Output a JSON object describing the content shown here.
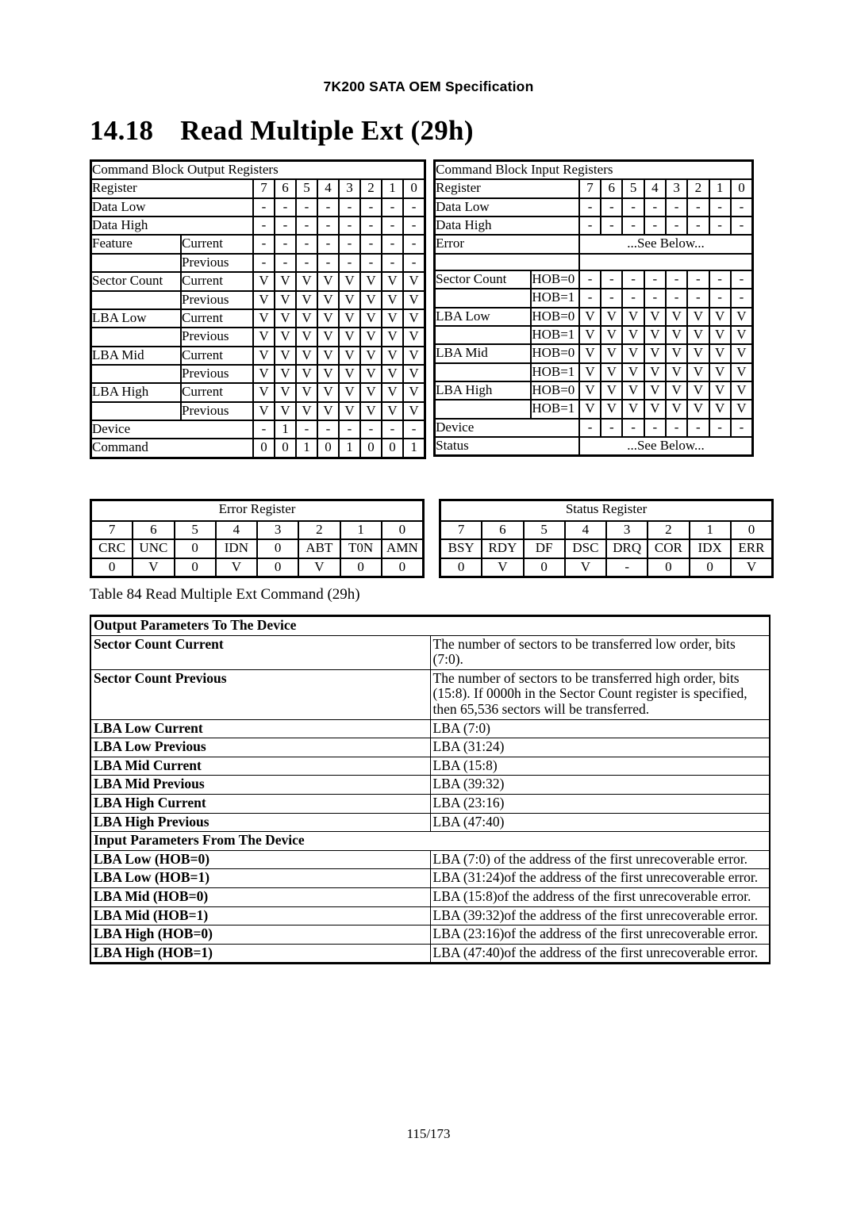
{
  "header": {
    "running_title": "7K200 SATA OEM Specification"
  },
  "section": {
    "number": "14.18",
    "title": "Read Multiple Ext (29h)"
  },
  "command_block": {
    "output": {
      "panel_title": "Command Block Output Registers",
      "register_label": "Register",
      "bit_headers": [
        "7",
        "6",
        "5",
        "4",
        "3",
        "2",
        "1",
        "0"
      ],
      "rows": [
        {
          "name": "Data Low",
          "sub": "",
          "values": [
            "-",
            "-",
            "-",
            "-",
            "-",
            "-",
            "-",
            "-"
          ]
        },
        {
          "name": "Data High",
          "sub": "",
          "values": [
            "-",
            "-",
            "-",
            "-",
            "-",
            "-",
            "-",
            "-"
          ]
        },
        {
          "name": "Feature",
          "sub": "Current",
          "values": [
            "-",
            "-",
            "-",
            "-",
            "-",
            "-",
            "-",
            "-"
          ]
        },
        {
          "name": "",
          "sub": "Previous",
          "values": [
            "-",
            "-",
            "-",
            "-",
            "-",
            "-",
            "-",
            "-"
          ]
        },
        {
          "name": "Sector Count",
          "sub": "Current",
          "values": [
            "V",
            "V",
            "V",
            "V",
            "V",
            "V",
            "V",
            "V"
          ]
        },
        {
          "name": "",
          "sub": "Previous",
          "values": [
            "V",
            "V",
            "V",
            "V",
            "V",
            "V",
            "V",
            "V"
          ]
        },
        {
          "name": "LBA Low",
          "sub": "Current",
          "values": [
            "V",
            "V",
            "V",
            "V",
            "V",
            "V",
            "V",
            "V"
          ]
        },
        {
          "name": "",
          "sub": "Previous",
          "values": [
            "V",
            "V",
            "V",
            "V",
            "V",
            "V",
            "V",
            "V"
          ]
        },
        {
          "name": "LBA Mid",
          "sub": "Current",
          "values": [
            "V",
            "V",
            "V",
            "V",
            "V",
            "V",
            "V",
            "V"
          ]
        },
        {
          "name": "",
          "sub": "Previous",
          "values": [
            "V",
            "V",
            "V",
            "V",
            "V",
            "V",
            "V",
            "V"
          ]
        },
        {
          "name": "LBA High",
          "sub": "Current",
          "values": [
            "V",
            "V",
            "V",
            "V",
            "V",
            "V",
            "V",
            "V"
          ]
        },
        {
          "name": "",
          "sub": "Previous",
          "values": [
            "V",
            "V",
            "V",
            "V",
            "V",
            "V",
            "V",
            "V"
          ]
        },
        {
          "name": "Device",
          "sub": "",
          "values": [
            "-",
            "1",
            "-",
            "-",
            "-",
            "-",
            "-",
            "-"
          ]
        },
        {
          "name": "Command",
          "sub": "",
          "values": [
            "0",
            "0",
            "1",
            "0",
            "1",
            "0",
            "0",
            "1"
          ]
        }
      ]
    },
    "input": {
      "panel_title": "Command Block Input Registers",
      "register_label": "Register",
      "bit_headers": [
        "7",
        "6",
        "5",
        "4",
        "3",
        "2",
        "1",
        "0"
      ],
      "see_below": "...See Below...",
      "rows": [
        {
          "name": "Data Low",
          "sub": "",
          "values": [
            "-",
            "-",
            "-",
            "-",
            "-",
            "-",
            "-",
            "-"
          ]
        },
        {
          "name": "Data High",
          "sub": "",
          "values": [
            "-",
            "-",
            "-",
            "-",
            "-",
            "-",
            "-",
            "-"
          ]
        },
        {
          "name": "Error",
          "sub": "",
          "see_below": true
        },
        {
          "name": "",
          "sub": "",
          "empty": true
        },
        {
          "name": "Sector Count",
          "sub": "HOB=0",
          "values": [
            "-",
            "-",
            "-",
            "-",
            "-",
            "-",
            "-",
            "-"
          ]
        },
        {
          "name": "",
          "sub": "HOB=1",
          "values": [
            "-",
            "-",
            "-",
            "-",
            "-",
            "-",
            "-",
            "-"
          ]
        },
        {
          "name": "LBA Low",
          "sub": "HOB=0",
          "values": [
            "V",
            "V",
            "V",
            "V",
            "V",
            "V",
            "V",
            "V"
          ]
        },
        {
          "name": "",
          "sub": "HOB=1",
          "values": [
            "V",
            "V",
            "V",
            "V",
            "V",
            "V",
            "V",
            "V"
          ]
        },
        {
          "name": "LBA Mid",
          "sub": "HOB=0",
          "values": [
            "V",
            "V",
            "V",
            "V",
            "V",
            "V",
            "V",
            "V"
          ]
        },
        {
          "name": "",
          "sub": "HOB=1",
          "values": [
            "V",
            "V",
            "V",
            "V",
            "V",
            "V",
            "V",
            "V"
          ]
        },
        {
          "name": "LBA High",
          "sub": "HOB=0",
          "values": [
            "V",
            "V",
            "V",
            "V",
            "V",
            "V",
            "V",
            "V"
          ]
        },
        {
          "name": "",
          "sub": "HOB=1",
          "values": [
            "V",
            "V",
            "V",
            "V",
            "V",
            "V",
            "V",
            "V"
          ]
        },
        {
          "name": "Device",
          "sub": "",
          "values": [
            "-",
            "-",
            "-",
            "-",
            "-",
            "-",
            "-",
            "-"
          ]
        },
        {
          "name": "Status",
          "sub": "",
          "see_below": true
        }
      ]
    }
  },
  "error_register": {
    "title": "Error Register",
    "bits": [
      "7",
      "6",
      "5",
      "4",
      "3",
      "2",
      "1",
      "0"
    ],
    "names": [
      "CRC",
      "UNC",
      "0",
      "IDN",
      "0",
      "ABT",
      "T0N",
      "AMN"
    ],
    "values": [
      "0",
      "V",
      "0",
      "V",
      "0",
      "V",
      "0",
      "0"
    ]
  },
  "status_register": {
    "title": "Status Register",
    "bits": [
      "7",
      "6",
      "5",
      "4",
      "3",
      "2",
      "1",
      "0"
    ],
    "names": [
      "BSY",
      "RDY",
      "DF",
      "DSC",
      "DRQ",
      "COR",
      "IDX",
      "ERR"
    ],
    "values": [
      "0",
      "V",
      "0",
      "V",
      "-",
      "0",
      "0",
      "V"
    ]
  },
  "caption": "Table 84 Read Multiple Ext Command (29h)",
  "parameters": {
    "output_header": "Output Parameters To The Device",
    "output_rows": [
      {
        "key": "Sector Count Current",
        "value": "The number of sectors to be transferred low order, bits (7:0)."
      },
      {
        "key": "Sector Count Previous",
        "value": "The number of sectors to be transferred high order, bits (15:8). If 0000h in the Sector Count register is specified, then 65,536 sectors will be transferred.",
        "two_line": true
      },
      {
        "key": "LBA Low Current",
        "value": "LBA (7:0)"
      },
      {
        "key": "LBA Low Previous",
        "value": "LBA (31:24)"
      },
      {
        "key": "LBA Mid Current",
        "value": "LBA (15:8)"
      },
      {
        "key": "LBA Mid Previous",
        "value": "LBA (39:32)"
      },
      {
        "key": "LBA High Current",
        "value": "LBA (23:16)"
      },
      {
        "key": "LBA High Previous",
        "value": "LBA (47:40)"
      }
    ],
    "input_header": "Input Parameters From The Device",
    "input_rows": [
      {
        "key": "LBA Low (HOB=0)",
        "value": "LBA (7:0) of the address of the first unrecoverable error."
      },
      {
        "key": "LBA Low (HOB=1)",
        "value": "LBA (31:24)of the address of the first unrecoverable error."
      },
      {
        "key": "LBA Mid (HOB=0)",
        "value": "LBA (15:8)of the address of the first unrecoverable error."
      },
      {
        "key": "LBA Mid (HOB=1)",
        "value": "LBA (39:32)of the address of the first unrecoverable error."
      },
      {
        "key": "LBA High (HOB=0)",
        "value": "LBA (23:16)of the address of the first unrecoverable error."
      },
      {
        "key": "LBA High (HOB=1)",
        "value": "LBA (47:40)of the address of the first unrecoverable error."
      }
    ]
  },
  "footer": {
    "page": "115/173"
  }
}
